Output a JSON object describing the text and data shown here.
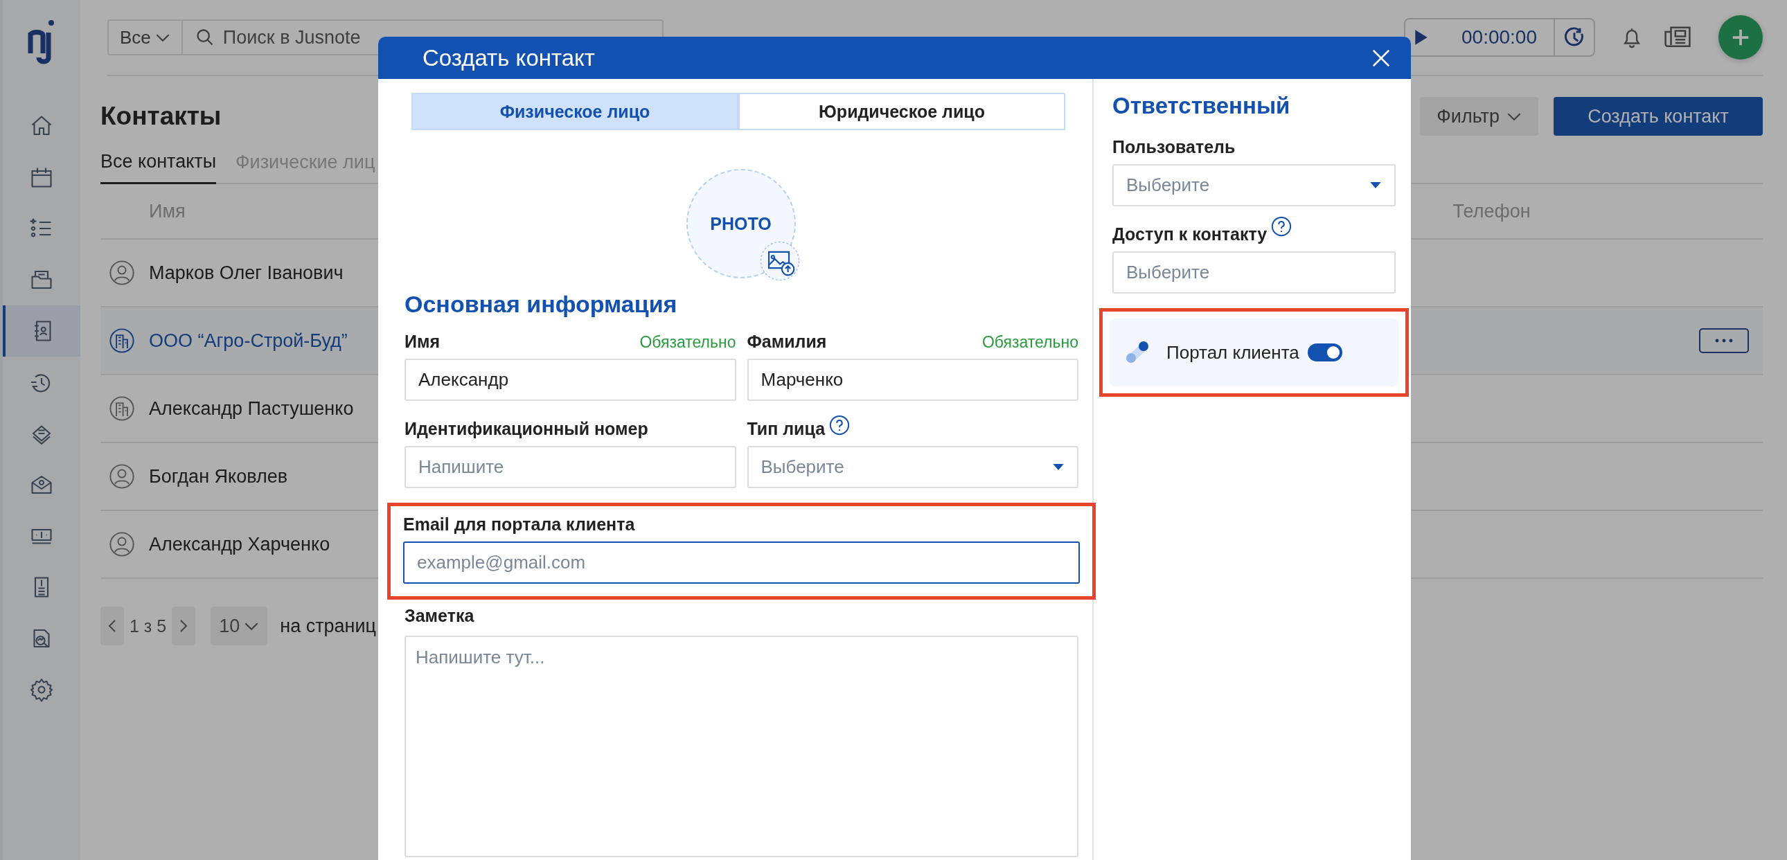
{
  "sidebar": {
    "items": [
      {
        "selected": false
      },
      {
        "selected": false
      },
      {
        "selected": false
      },
      {
        "selected": false
      },
      {
        "selected": true
      },
      {
        "selected": false
      },
      {
        "selected": false
      },
      {
        "selected": false
      },
      {
        "selected": false
      },
      {
        "selected": false
      },
      {
        "selected": false
      },
      {
        "selected": false
      }
    ]
  },
  "top_bar": {
    "scope": "Все",
    "search_placeholder": "Поиск в Jusnote",
    "timer": "00:00:00"
  },
  "page": {
    "title": "Контакты",
    "filter_button": "Фильтр",
    "create_button": "Создать контакт",
    "tabs": [
      {
        "label": "Все контакты",
        "selected": true
      },
      {
        "label": "Физические лиц",
        "selected": false
      }
    ],
    "columns": [
      "Имя",
      "Телефон"
    ],
    "rows": [
      {
        "name": "Марков Олег Іванович",
        "kind": "person",
        "selected": false
      },
      {
        "name": "ООО “Агро-Строй-Буд”",
        "kind": "company",
        "selected": true
      },
      {
        "name": "Александр Пастушенко",
        "kind": "company",
        "selected": false
      },
      {
        "name": "Богдан Яковлев",
        "kind": "person",
        "selected": false
      },
      {
        "name": "Александр Харченко",
        "kind": "person",
        "selected": false
      }
    ],
    "pagination": {
      "range": "1 з 5",
      "page_size": "10",
      "per_page_label": "на страниц"
    }
  },
  "modal": {
    "title": "Создать контакт",
    "type_tabs": [
      {
        "label": "Физическое лицо",
        "selected": true
      },
      {
        "label": "Юридическое лицо",
        "selected": false
      }
    ],
    "photo_label": "PHOTO",
    "section_title": "Основная информация",
    "fields": [
      {
        "kind": "text",
        "label": "Имя",
        "required_note": "Обязательно",
        "value": "Александр",
        "highlighted": false,
        "focused": false
      },
      {
        "kind": "text",
        "label": "Фамилия",
        "required_note": "Обязательно",
        "value": "Марченко",
        "highlighted": false,
        "focused": false
      },
      {
        "kind": "text",
        "label": "Идентификационный номер",
        "placeholder": "Напишите",
        "highlighted": false,
        "focused": false
      },
      {
        "kind": "select",
        "label": "Тип лица",
        "help": true,
        "placeholder": "Выберите",
        "highlighted": false,
        "focused": false
      },
      {
        "kind": "email",
        "label": "Email для портала клиента",
        "placeholder": "example@gmail.com",
        "highlighted": true,
        "focused": true
      }
    ],
    "note": {
      "label": "Заметка",
      "placeholder": "Напишите тут..."
    },
    "side": {
      "title": "Ответственный",
      "fields": [
        {
          "kind": "select",
          "label": "Пользователь",
          "placeholder": "Выберите"
        },
        {
          "kind": "text",
          "label": "Доступ к контакту",
          "help": true,
          "placeholder": "Выберите"
        }
      ],
      "portal": {
        "label": "Портал клиента",
        "on": true,
        "highlighted": true
      }
    }
  }
}
